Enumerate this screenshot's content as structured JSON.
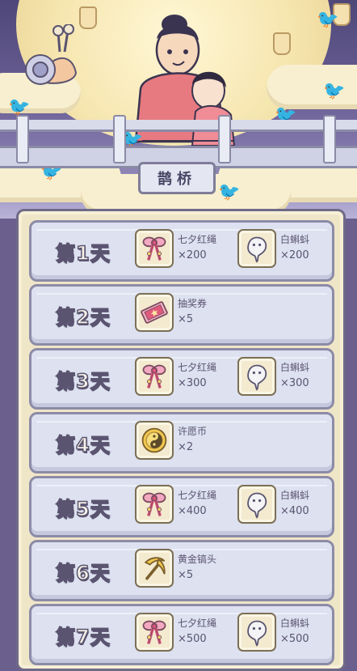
{
  "scene": {
    "bridge_sign": "鹊桥"
  },
  "rewards": [
    {
      "day": "第1天",
      "items": [
        {
          "name": "七夕红绳",
          "qty": "×200",
          "icon": "red-cord-icon"
        },
        {
          "name": "白蝌蚪",
          "qty": "×200",
          "icon": "white-tadpole-icon"
        }
      ]
    },
    {
      "day": "第2天",
      "items": [
        {
          "name": "抽奖券",
          "qty": "×5",
          "icon": "lottery-ticket-icon"
        }
      ]
    },
    {
      "day": "第3天",
      "items": [
        {
          "name": "七夕红绳",
          "qty": "×300",
          "icon": "red-cord-icon"
        },
        {
          "name": "白蝌蚪",
          "qty": "×300",
          "icon": "white-tadpole-icon"
        }
      ]
    },
    {
      "day": "第4天",
      "items": [
        {
          "name": "许愿币",
          "qty": "×2",
          "icon": "wish-coin-icon"
        }
      ]
    },
    {
      "day": "第5天",
      "items": [
        {
          "name": "七夕红绳",
          "qty": "×400",
          "icon": "red-cord-icon"
        },
        {
          "name": "白蝌蚪",
          "qty": "×400",
          "icon": "white-tadpole-icon"
        }
      ]
    },
    {
      "day": "第6天",
      "items": [
        {
          "name": "黄金镐头",
          "qty": "×5",
          "icon": "golden-pickaxe-icon"
        }
      ]
    },
    {
      "day": "第7天",
      "items": [
        {
          "name": "七夕红绳",
          "qty": "×500",
          "icon": "red-cord-icon"
        },
        {
          "name": "白蝌蚪",
          "qty": "×500",
          "icon": "white-tadpole-icon"
        }
      ]
    }
  ]
}
